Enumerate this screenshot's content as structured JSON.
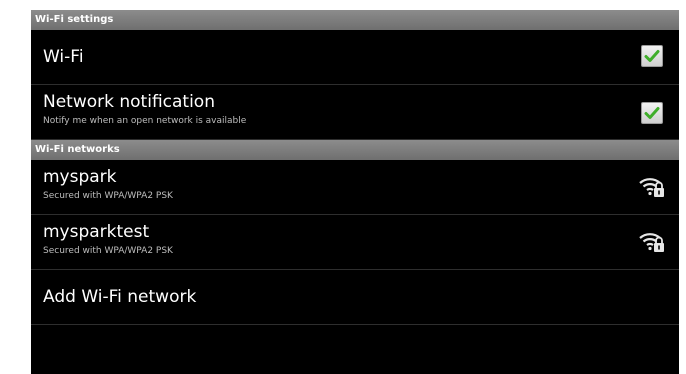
{
  "header_wifi_settings": "Wi-Fi settings",
  "wifi": {
    "label": "Wi-Fi",
    "checked": true
  },
  "network_notification": {
    "label": "Network notification",
    "summary": "Notify me when an open network is available",
    "checked": true
  },
  "header_wifi_networks": "Wi-Fi networks",
  "networks": [
    {
      "ssid": "myspark",
      "security": "Secured with WPA/WPA2 PSK",
      "icon": "wifi-lock-icon"
    },
    {
      "ssid": "mysparktest",
      "security": "Secured with WPA/WPA2 PSK",
      "icon": "wifi-lock-icon"
    }
  ],
  "add_network": {
    "label": "Add Wi-Fi network"
  },
  "colors": {
    "checkmark": "#3fae2a",
    "header_bg": "#7a7a7a",
    "background": "#000000"
  }
}
